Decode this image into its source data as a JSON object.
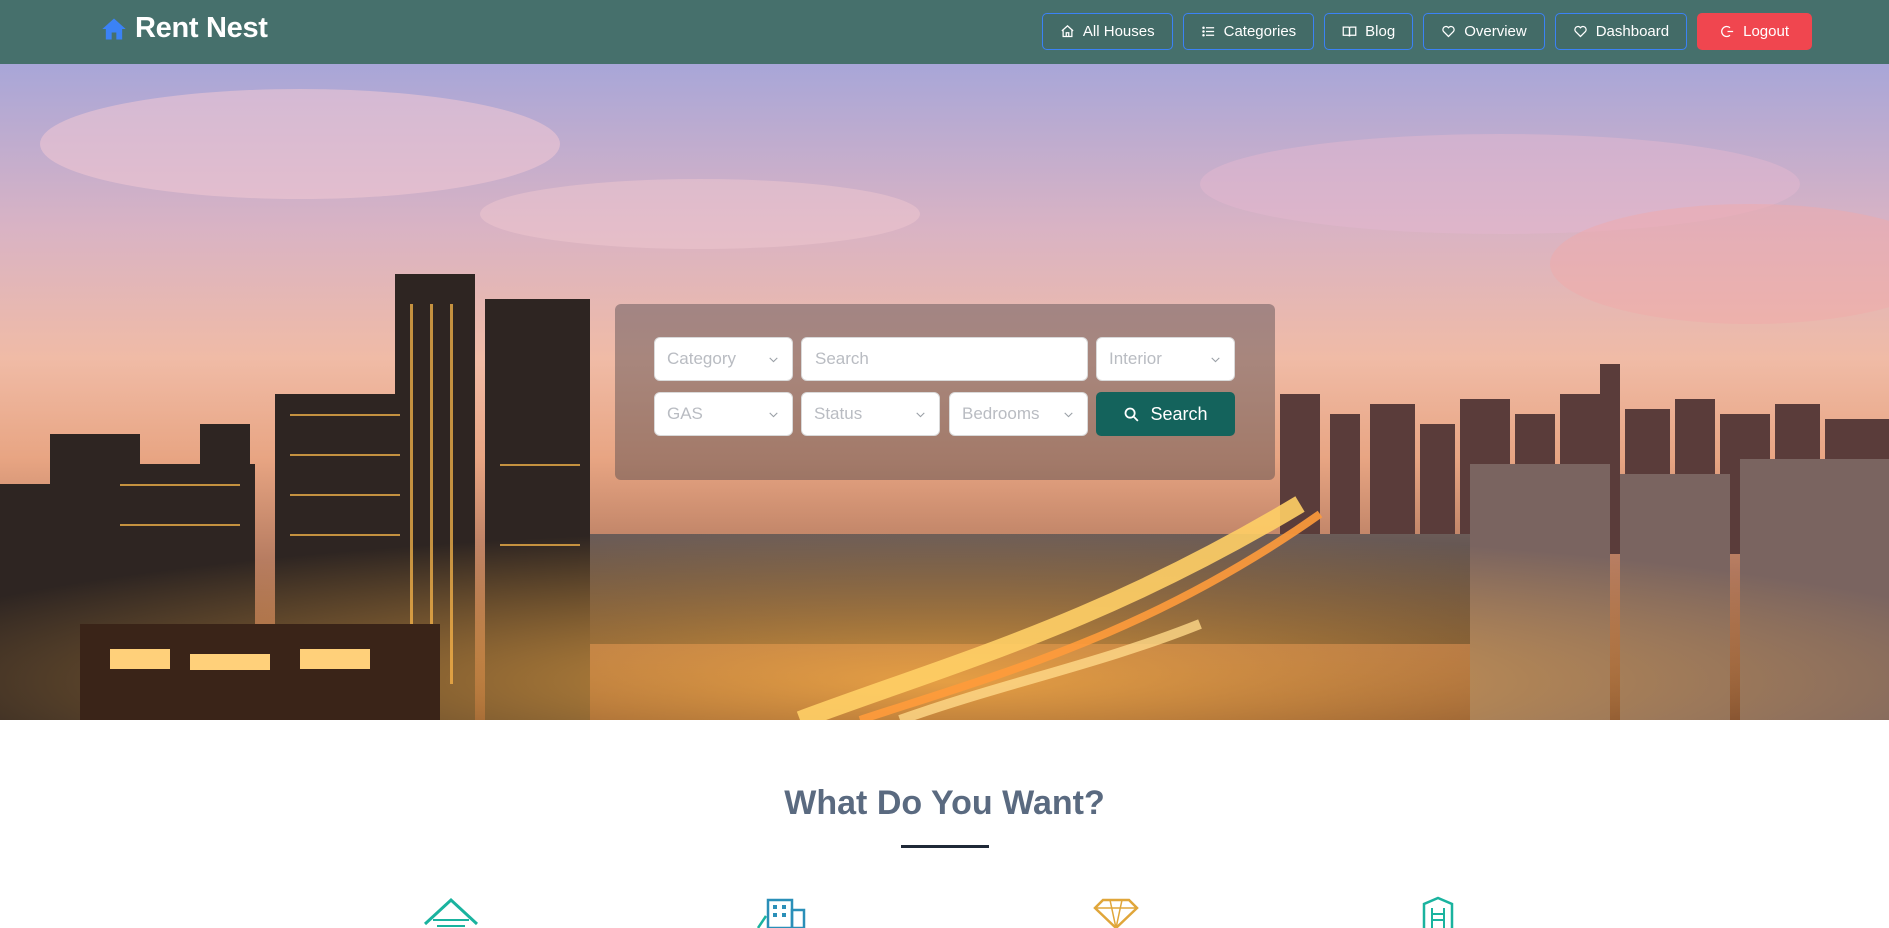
{
  "brand": {
    "name": "Rent Nest",
    "icon": "home-icon",
    "icon_color": "#3b82f6"
  },
  "nav": {
    "items": [
      {
        "label": "All Houses",
        "icon": "home-outline-icon"
      },
      {
        "label": "Categories",
        "icon": "list-icon"
      },
      {
        "label": "Blog",
        "icon": "book-icon"
      },
      {
        "label": "Overview",
        "icon": "heart-icon"
      },
      {
        "label": "Dashboard",
        "icon": "heart-icon"
      }
    ],
    "logout": {
      "label": "Logout",
      "icon": "logout-icon",
      "color": "#f0464f"
    }
  },
  "search": {
    "category": {
      "placeholder": "Category"
    },
    "query": {
      "placeholder": "Search"
    },
    "interior": {
      "placeholder": "Interior"
    },
    "gas": {
      "placeholder": "GAS"
    },
    "status": {
      "placeholder": "Status"
    },
    "bedrooms": {
      "placeholder": "Bedrooms"
    },
    "button_label": "Search",
    "button_color": "#14635c"
  },
  "section": {
    "title": "What Do You Want?",
    "features": [
      {
        "icon": "house-roof-icon"
      },
      {
        "icon": "apartment-building-icon"
      },
      {
        "icon": "diamond-icon"
      },
      {
        "icon": "office-building-icon"
      }
    ]
  },
  "colors": {
    "navbar": "#46706c",
    "title": "#5a6a80"
  }
}
